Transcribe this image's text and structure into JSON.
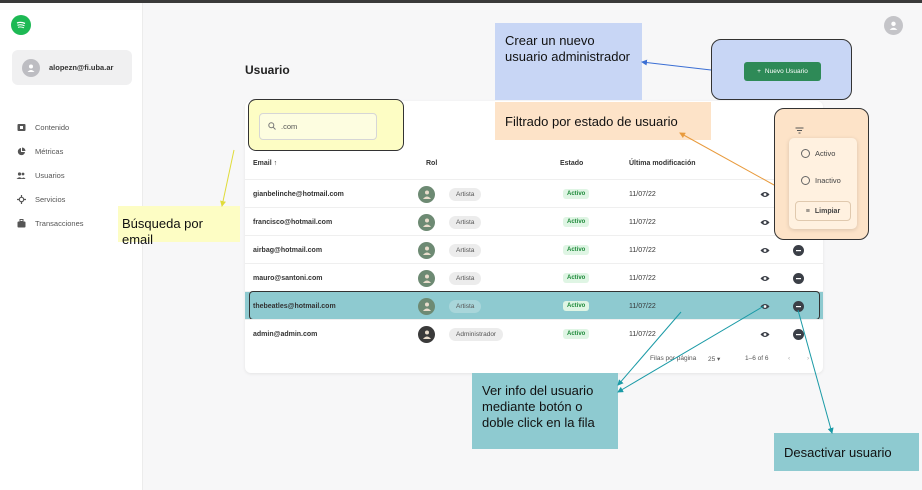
{
  "sidebar": {
    "user_email": "alopezn@fi.uba.ar",
    "items": [
      {
        "label": "Contenido",
        "icon": "content-icon"
      },
      {
        "label": "Métricas",
        "icon": "pie-chart-icon"
      },
      {
        "label": "Usuarios",
        "icon": "users-icon"
      },
      {
        "label": "Servicios",
        "icon": "services-icon"
      },
      {
        "label": "Transacciones",
        "icon": "transactions-icon"
      }
    ]
  },
  "header": {
    "title": "Usuario"
  },
  "toolbar": {
    "new_user_label": "Nuevo Usuario"
  },
  "search": {
    "value": ".com"
  },
  "table": {
    "columns": [
      "Email ↑",
      "Rol",
      "Estado",
      "Última modificación"
    ],
    "rows": [
      {
        "email": "gianbelinche@hotmail.com",
        "role": "Artista",
        "status": "Activo",
        "modified": "11/07/22"
      },
      {
        "email": "francisco@hotmail.com",
        "role": "Artista",
        "status": "Activo",
        "modified": "11/07/22"
      },
      {
        "email": "airbag@hotmail.com",
        "role": "Artista",
        "status": "Activo",
        "modified": "11/07/22"
      },
      {
        "email": "mauro@santoni.com",
        "role": "Artista",
        "status": "Activo",
        "modified": "11/07/22"
      },
      {
        "email": "thebeatles@hotmail.com",
        "role": "Artista",
        "status": "Activo",
        "modified": "11/07/22"
      },
      {
        "email": "admin@admin.com",
        "role": "Administrador",
        "status": "Activo",
        "modified": "11/07/22"
      }
    ],
    "pagination": {
      "rows_per_page_label": "Filas por página",
      "rows_per_page": "25",
      "range": "1–6 of 6"
    }
  },
  "filter": {
    "options": [
      "Activo",
      "Inactivo"
    ],
    "clear_label": "Limpiar"
  },
  "callouts": {
    "new_admin": "Crear un nuevo usuario administrador",
    "filter_status": "Filtrado por estado de usuario",
    "search_email": "Búsqueda por email",
    "view_info": "Ver info del usuario mediante botón o doble click en la fila",
    "deactivate": "Desactivar usuario"
  },
  "colors": {
    "accent": "#1db954",
    "button": "#2e8a57",
    "highlight": "#8ecad0"
  }
}
